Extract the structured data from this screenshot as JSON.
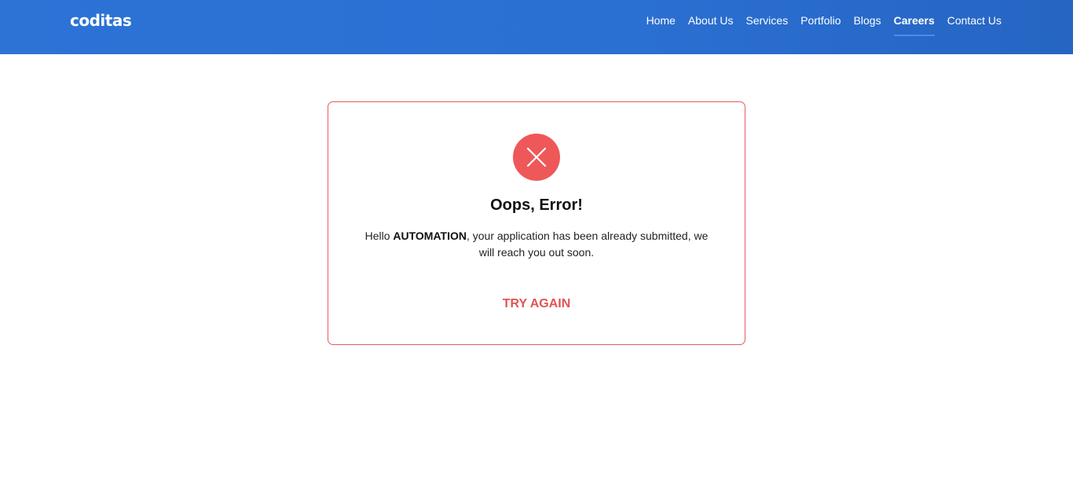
{
  "header": {
    "logo_text": "coditas",
    "nav": [
      {
        "label": "Home"
      },
      {
        "label": "About Us"
      },
      {
        "label": "Services"
      },
      {
        "label": "Portfolio"
      },
      {
        "label": "Blogs"
      },
      {
        "label": "Careers",
        "active": true
      },
      {
        "label": "Contact Us"
      }
    ]
  },
  "dialog": {
    "icon": "close-x-icon",
    "title": "Oops, Error!",
    "message_prefix": "Hello ",
    "user_name": "AUTOMATION",
    "message_suffix": ", your application has been already submitted, we will reach you out soon.",
    "action_label": "TRY AGAIN"
  },
  "colors": {
    "header_bg": "#2a6fd2",
    "error": "#ef5858",
    "action": "#e25454"
  }
}
